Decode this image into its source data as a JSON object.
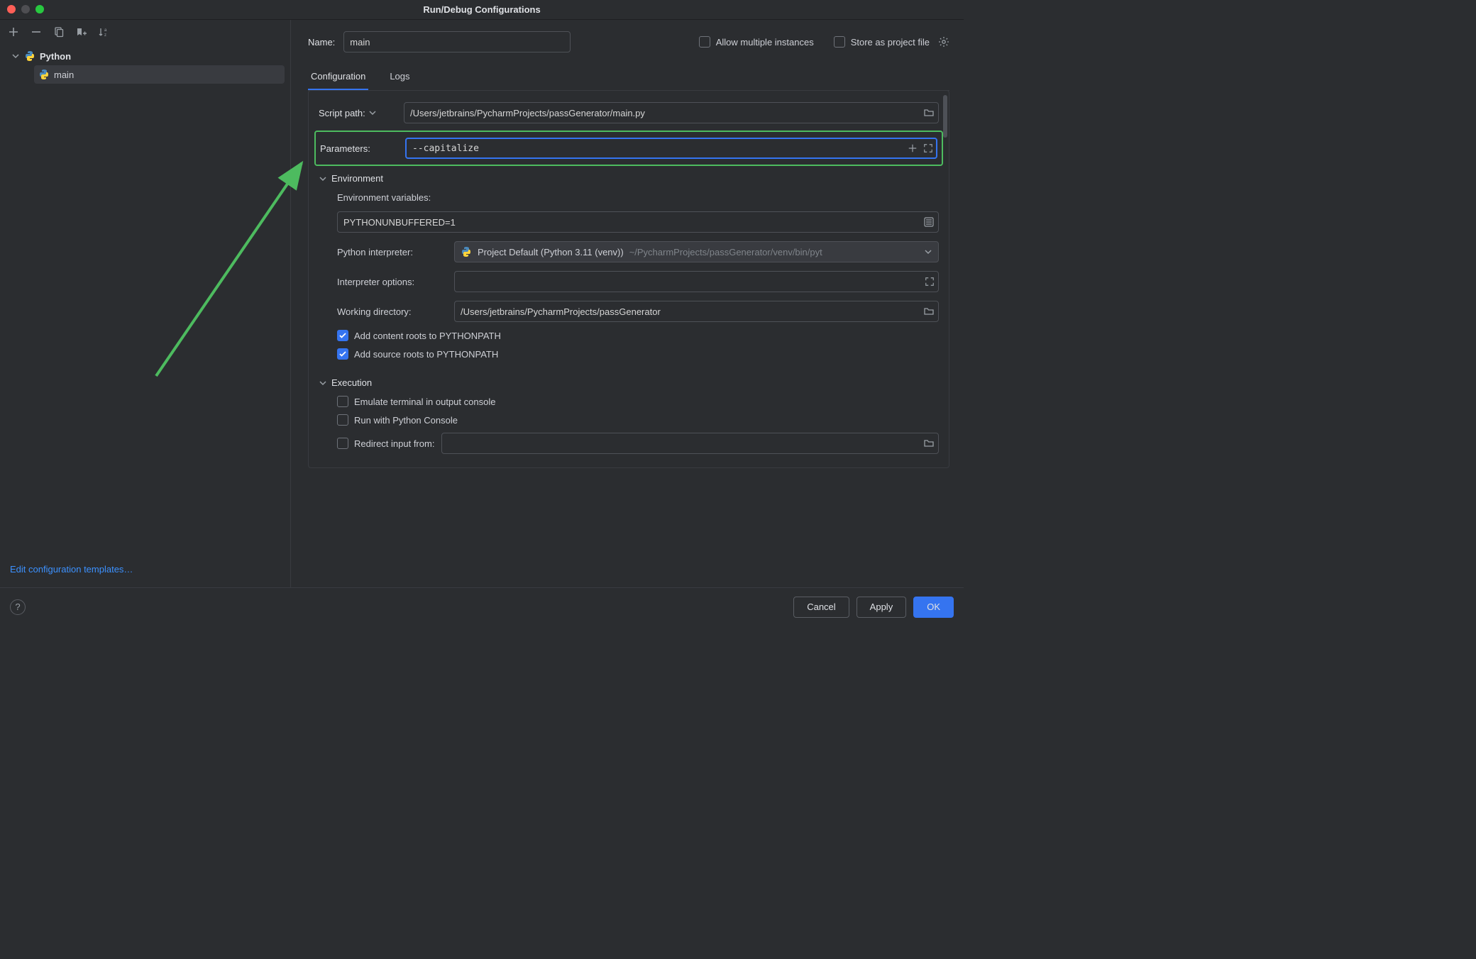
{
  "window": {
    "title": "Run/Debug Configurations"
  },
  "sidebar": {
    "group_label": "Python",
    "item_label": "main",
    "footer_link": "Edit configuration templates…"
  },
  "topform": {
    "name_label": "Name:",
    "name_value": "main",
    "allow_multiple_label": "Allow multiple instances",
    "store_as_file_label": "Store as project file"
  },
  "tabs": {
    "configuration": "Configuration",
    "logs": "Logs"
  },
  "config": {
    "script_path_label": "Script path:",
    "script_path_value": "/Users/jetbrains/PycharmProjects/passGenerator/main.py",
    "parameters_label": "Parameters:",
    "parameters_value": "--capitalize",
    "environment_header": "Environment",
    "env_vars_label": "Environment variables:",
    "env_vars_value": "PYTHONUNBUFFERED=1",
    "interpreter_label": "Python interpreter:",
    "interpreter_value": "Project Default (Python 3.11 (venv))",
    "interpreter_path": "~/PycharmProjects/passGenerator/venv/bin/pyt",
    "interpreter_options_label": "Interpreter options:",
    "working_dir_label": "Working directory:",
    "working_dir_value": "/Users/jetbrains/PycharmProjects/passGenerator",
    "add_content_roots_label": "Add content roots to PYTHONPATH",
    "add_source_roots_label": "Add source roots to PYTHONPATH",
    "execution_header": "Execution",
    "emulate_terminal_label": "Emulate terminal in output console",
    "run_with_console_label": "Run with Python Console",
    "redirect_input_label": "Redirect input from:"
  },
  "buttons": {
    "cancel": "Cancel",
    "apply": "Apply",
    "ok": "OK"
  }
}
